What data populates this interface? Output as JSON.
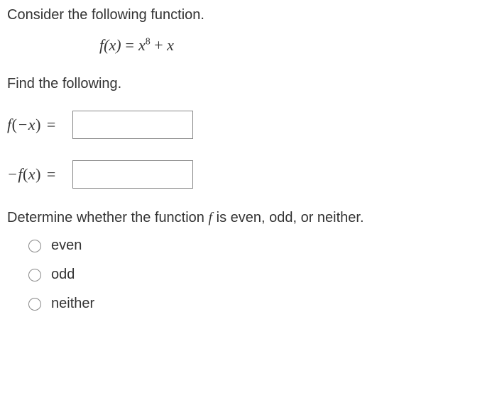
{
  "prompt1": "Consider the following function.",
  "formula": {
    "lhs": "f(x)",
    "eq": "=",
    "base": "x",
    "exp": "8",
    "plus": " + ",
    "term2": "x"
  },
  "prompt2": "Find the following.",
  "rows": [
    {
      "label_prefix": "f",
      "label_inner": "−x",
      "eq": "=",
      "value": ""
    },
    {
      "label_prefix": "−f",
      "label_inner": "x",
      "eq": "=",
      "value": ""
    }
  ],
  "prompt3_pre": "Determine whether the function ",
  "prompt3_f": "f",
  "prompt3_post": " is even, odd, or neither.",
  "options": [
    {
      "label": "even"
    },
    {
      "label": "odd"
    },
    {
      "label": "neither"
    }
  ]
}
